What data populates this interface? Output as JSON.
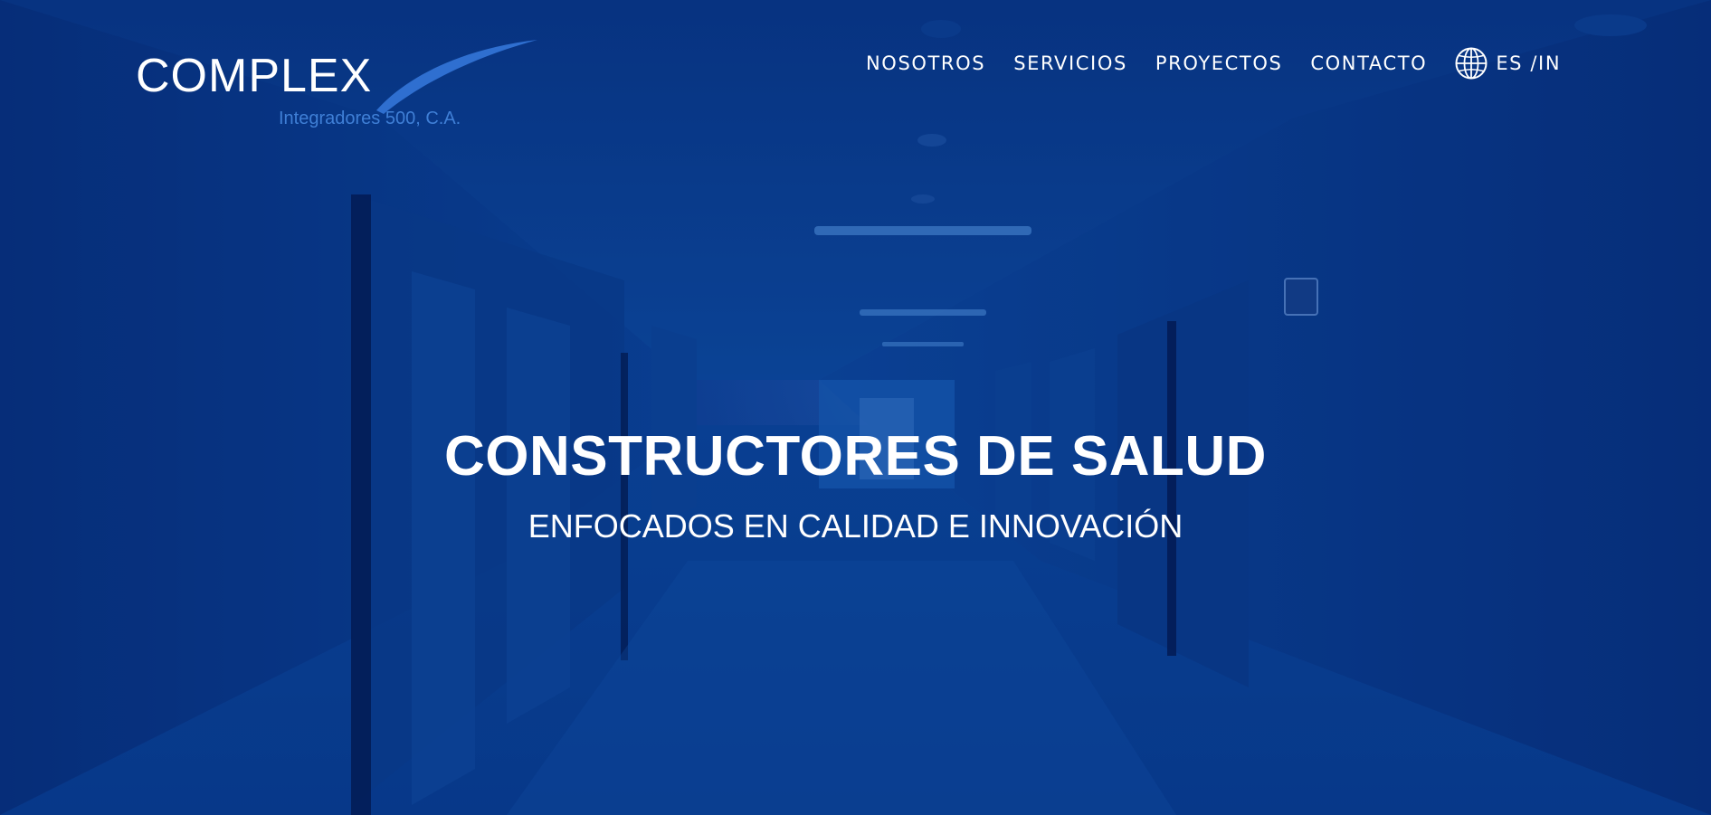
{
  "brand": {
    "name": "COMPLEX",
    "tagline": "Integradores 500, C.A."
  },
  "nav": {
    "items": [
      {
        "label": "NOSOTROS"
      },
      {
        "label": "SERVICIOS"
      },
      {
        "label": "PROYECTOS"
      },
      {
        "label": "CONTACTO"
      }
    ],
    "language": {
      "label": "ES /IN",
      "icon": "globe-icon"
    }
  },
  "hero": {
    "title": "CONSTRUCTORES DE SALUD",
    "subtitle": "ENFOCADOS EN CALIDAD E INNOVACIÓN",
    "background": "hospital-corridor-image"
  },
  "colors": {
    "overlay": "#0a3784",
    "text": "#ffffff",
    "brand_accent": "#3f7fd6"
  }
}
